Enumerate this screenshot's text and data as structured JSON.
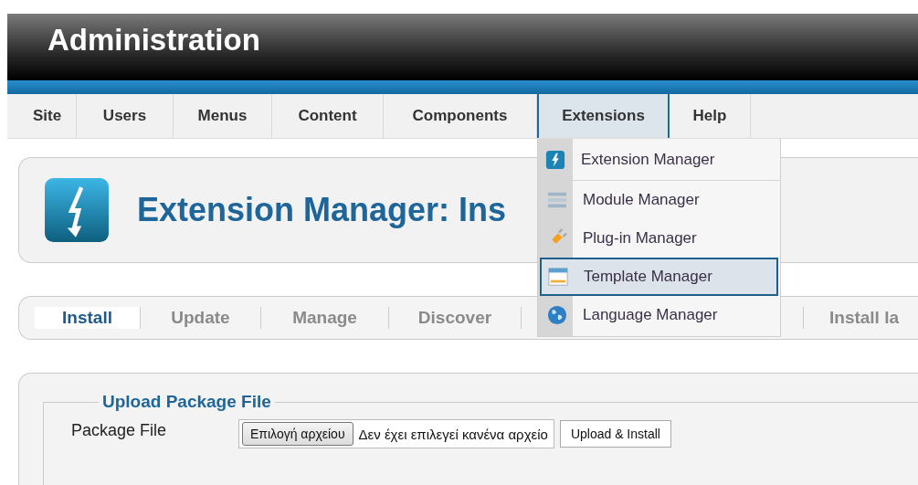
{
  "header": {
    "title": "Administration"
  },
  "menu": [
    {
      "label": "Site",
      "selected": false
    },
    {
      "label": "Users",
      "selected": false
    },
    {
      "label": "Menus",
      "selected": false
    },
    {
      "label": "Content",
      "selected": false
    },
    {
      "label": "Components",
      "selected": false
    },
    {
      "label": "Extensions",
      "selected": true
    },
    {
      "label": "Help",
      "selected": false
    }
  ],
  "dropdown": {
    "items": [
      {
        "label": "Extension Manager",
        "selected": false
      },
      {
        "label": "Module Manager",
        "selected": false
      },
      {
        "label": "Plug-in Manager",
        "selected": false
      },
      {
        "label": "Template Manager",
        "selected": true
      },
      {
        "label": "Language Manager",
        "selected": false
      }
    ]
  },
  "page_title": "Extension Manager: Ins",
  "subtabs": [
    {
      "label": "Install",
      "selected": true
    },
    {
      "label": "Update",
      "selected": false
    },
    {
      "label": "Manage",
      "selected": false
    },
    {
      "label": "Discover",
      "selected": false
    },
    {
      "label": "Install la",
      "selected": false
    }
  ],
  "upload": {
    "legend": "Upload Package File",
    "label": "Package File",
    "choose_button": "Επιλογή αρχείου",
    "file_status": "Δεν έχει επιλεγεί κανένα αρχείο",
    "submit_button": "Upload & Install"
  }
}
